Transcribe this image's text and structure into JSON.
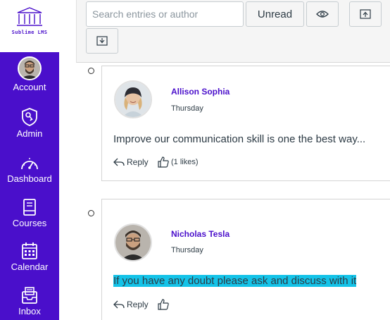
{
  "brand": {
    "name": "Sublime LMS",
    "color": "#4a0fcb"
  },
  "sidebar": {
    "items": [
      {
        "label": "Account",
        "icon": "user-avatar"
      },
      {
        "label": "Admin",
        "icon": "shield-key-icon"
      },
      {
        "label": "Dashboard",
        "icon": "speedometer-icon"
      },
      {
        "label": "Courses",
        "icon": "book-icon"
      },
      {
        "label": "Calendar",
        "icon": "calendar-icon"
      },
      {
        "label": "Inbox",
        "icon": "inbox-icon"
      }
    ]
  },
  "toolbar": {
    "search_placeholder": "Search entries or author",
    "unread_label": "Unread",
    "icons": [
      "eye-icon",
      "upload-icon",
      "download-icon"
    ]
  },
  "entries": [
    {
      "author": "Allison Sophia",
      "date": "Thursday",
      "message": "Improve our communication skill is one the best way...",
      "reply_label": "Reply",
      "likes_label": "(1 likes)",
      "highlighted": false
    },
    {
      "author": "Nicholas Tesla",
      "date": "Thursday",
      "message": "If you have any doubt please ask and discuss with it",
      "reply_label": "Reply",
      "likes_label": "",
      "highlighted": true,
      "highlight_color": "#14c3e8"
    }
  ]
}
